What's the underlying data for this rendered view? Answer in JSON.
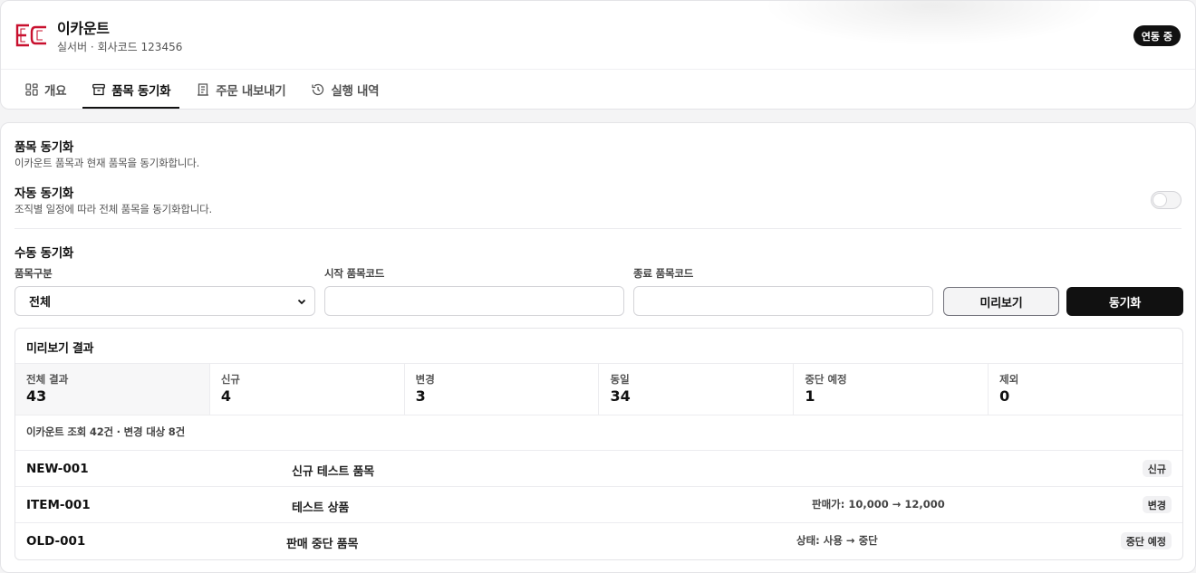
{
  "header": {
    "shop_name": "이카운트",
    "shop_sub": "실서버 · 회사코드 123456",
    "status": "연동 중",
    "logo_text": "EC",
    "tabs": [
      {
        "label": "개요",
        "icon": "dashboard-icon"
      },
      {
        "label": "품목 동기화",
        "icon": "box-icon",
        "active": true
      },
      {
        "label": "주문 내보내기",
        "icon": "document-icon"
      },
      {
        "label": "실행 내역",
        "icon": "history-icon"
      }
    ]
  },
  "sync": {
    "title": "품목 동기화",
    "desc": "이카운트 품목과 현재 품목을 동기화합니다.",
    "auto_title": "자동 동기화",
    "auto_desc": "조직별 일정에 따라 전체 품목을 동기화합니다.",
    "auto_enabled": false,
    "manual_title": "수동 동기화",
    "category_label": "품목구분",
    "category_value": "전체",
    "start_code_label": "시작 품목코드",
    "start_code_value": "",
    "end_code_label": "종료 품목코드",
    "end_code_value": "",
    "preview_button": "미리보기",
    "sync_button": "동기화"
  },
  "preview": {
    "title": "미리보기 결과",
    "stats": [
      {
        "label": "전체 결과",
        "value": "43"
      },
      {
        "label": "신규",
        "value": "4"
      },
      {
        "label": "변경",
        "value": "3"
      },
      {
        "label": "동일",
        "value": "34"
      },
      {
        "label": "중단 예정",
        "value": "1"
      },
      {
        "label": "제외",
        "value": "0"
      }
    ],
    "summary": "이카운트 조회 42건 · 변경 대상 8건",
    "rows": [
      {
        "code": "NEW-001",
        "name": "신규 테스트 품목",
        "change": "",
        "badge": "신규"
      },
      {
        "code": "ITEM-001",
        "name": "테스트 상품",
        "change": "판매가: 10,000 → 12,000",
        "badge": "변경"
      },
      {
        "code": "OLD-001",
        "name": "판매 중단 품목",
        "change": "상태: 사용 → 중단",
        "badge": "중단 예정"
      }
    ]
  },
  "colors": {
    "logo_red": "#c8102e",
    "primary": "#111111"
  }
}
